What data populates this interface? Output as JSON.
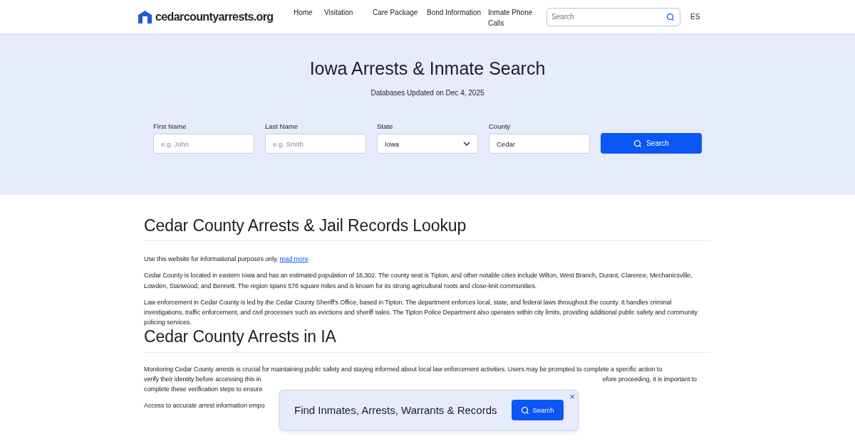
{
  "header": {
    "logo": "cedarcountyarrests.org",
    "nav": [
      "Home",
      "Visitation",
      "Care Package",
      "Bond Information",
      "Inmate Phone Calls"
    ],
    "search": {
      "placeholder": "Search"
    },
    "language": "ES"
  },
  "hero": {
    "title": "Iowa Arrests & Inmate Search",
    "subtitle": "Databases Updated on Dec 4, 2025",
    "fields": [
      {
        "kind": "text",
        "label": "First Name",
        "placeholder": "e.g. John"
      },
      {
        "kind": "text",
        "label": "Last Name",
        "placeholder": "e.g. Smith"
      },
      {
        "kind": "select",
        "label": "State",
        "value": "Iowa"
      },
      {
        "kind": "text",
        "label": "County",
        "value": "Cedar"
      }
    ],
    "button": "Search"
  },
  "article": {
    "title": "Cedar County Arrests & Jail Records Lookup",
    "intro": "Use this website for informational purposes only, ",
    "intro_link": "read more",
    "intro_end": ".",
    "paragraphs": [
      "Cedar County is located in eastern Iowa and has an estimated population of 18,302. The county seat is Tipton, and other notable cities include Wilton, West Branch, Durant, Clarence, Mechanicsville, Lowden, Stanwood, and Bennett. The region spans 576 square miles and is known for its strong agricultural roots and close-knit communities.",
      "Law enforcement in Cedar County is led by the Cedar County Sheriff's Office, based in Tipton. The department enforces local, state, and federal laws throughout the county. It handles criminal investigations, traffic enforcement, and civil processes such as evictions and sheriff sales. The Tipton Police Department also operates within city limits, providing additional public safety and community policing services."
    ],
    "section_title": "Cedar County Arrests in IA",
    "covered_lines": [
      {
        "left": "Monitoring Cedar County arrests is crucial for maintaining public safety and staying informed about local law enforcement activities. Users may be prompted to complete a specific action to"
      },
      {
        "left": "verify their identity before accessing this in",
        "right": "efore proceeding, it is important to"
      },
      {
        "left": "complete these verification steps to ensure"
      }
    ],
    "last_line": "Access to accurate arrest information empo"
  },
  "popup": {
    "title": "Find Inmates, Arrests, Warrants & Records",
    "button": "Search",
    "close": "×"
  }
}
